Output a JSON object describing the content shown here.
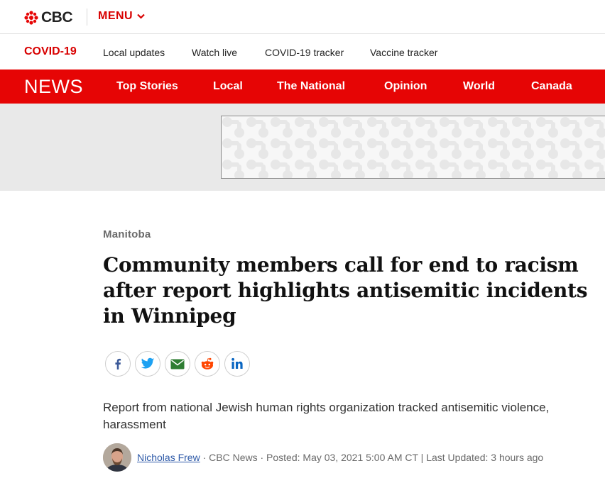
{
  "header": {
    "logo_text": "CBC",
    "menu_label": "MENU"
  },
  "covid_bar": {
    "label": "COVID-19",
    "links": [
      "Local updates",
      "Watch live",
      "COVID-19 tracker",
      "Vaccine tracker"
    ]
  },
  "news_bar": {
    "label": "NEWS",
    "links": [
      "Top Stories",
      "Local",
      "The National",
      "Opinion",
      "World",
      "Canada"
    ]
  },
  "article": {
    "category": "Manitoba",
    "headline": "Community members call for end to racism after report highlights antisemitic incidents in Winnipeg",
    "deck": "Report from national Jewish human rights organization tracked antisemitic violence, harassment",
    "author": "Nicholas Frew",
    "byline_rest": " · CBC News · Posted: May 03, 2021 5:00 AM CT | Last Updated: 3 hours ago"
  },
  "share_icons": [
    "facebook-icon",
    "twitter-icon",
    "email-icon",
    "reddit-icon",
    "linkedin-icon"
  ],
  "colors": {
    "brand_red": "#e60505",
    "accent_red": "#d80000",
    "link_blue": "#2e5aa8",
    "facebook": "#3b5998",
    "twitter": "#1da1f2",
    "email": "#2e7d32",
    "reddit": "#ff4500",
    "linkedin": "#0a66c2"
  }
}
